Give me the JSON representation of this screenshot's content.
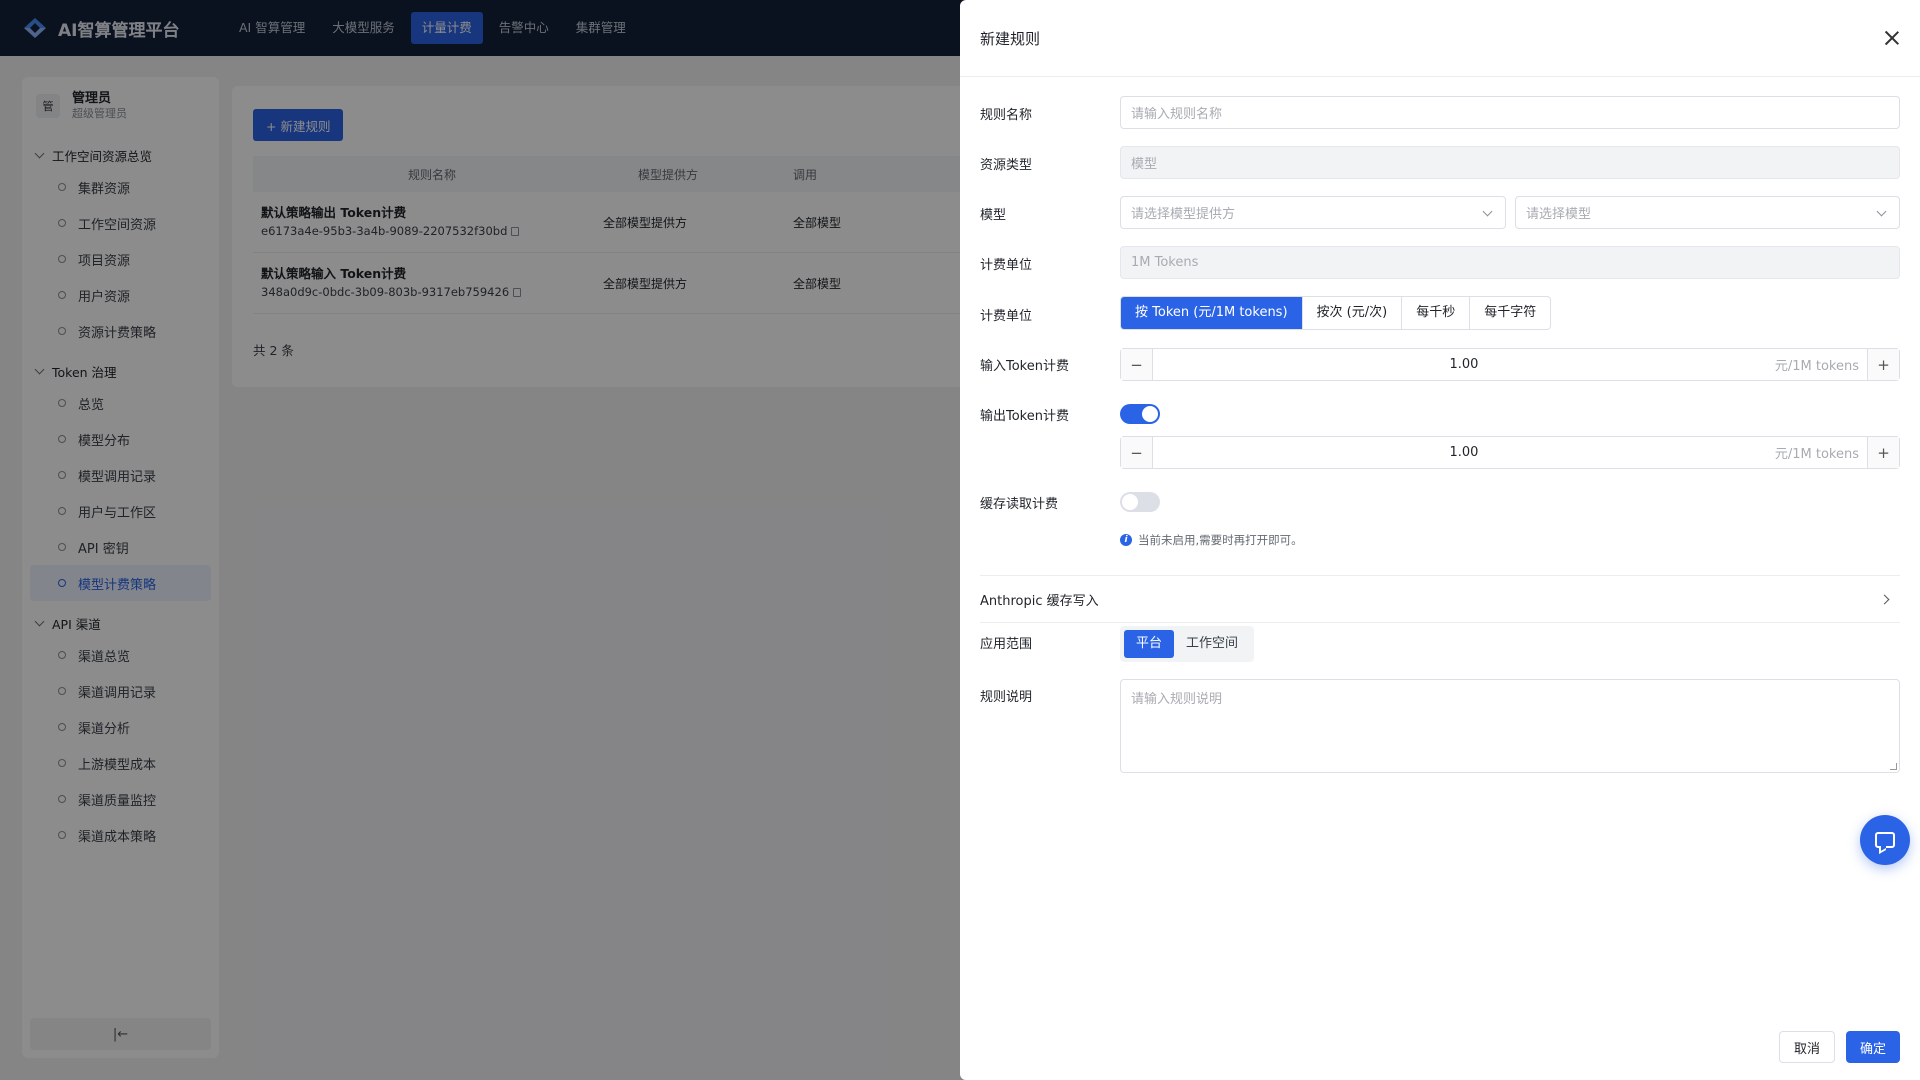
{
  "app": {
    "title": "AI智算管理平台"
  },
  "topnav": {
    "items": [
      {
        "label": "AI 智算管理"
      },
      {
        "label": "大模型服务"
      },
      {
        "label": "计量计费",
        "active": true
      },
      {
        "label": "告警中心"
      },
      {
        "label": "集群管理"
      }
    ]
  },
  "sidebar": {
    "user": {
      "avatar": "管",
      "name": "管理员",
      "role": "超级管理员"
    },
    "groups": [
      {
        "title": "工作空间资源总览",
        "items": [
          "集群资源",
          "工作空间资源",
          "项目资源",
          "用户资源",
          "资源计费策略"
        ]
      },
      {
        "title": "Token 治理",
        "items": [
          "总览",
          "模型分布",
          "模型调用记录",
          "用户与工作区",
          "API 密钥",
          "模型计费策略"
        ]
      },
      {
        "title": "API 渠道",
        "items": [
          "渠道总览",
          "渠道调用记录",
          "渠道分析",
          "上游模型成本",
          "渠道质量监控",
          "渠道成本策略"
        ]
      }
    ],
    "active_item": "模型计费策略",
    "collapse_label": "|←"
  },
  "main": {
    "new_button": "+ 新建规则",
    "columns": [
      "规则名称",
      "模型提供方",
      "调用"
    ],
    "rows": [
      {
        "name": "默认策略输出 Token计费",
        "id": "e6173a4e-95b3-3a4b-9089-2207532f30bd",
        "provider": "全部模型提供方",
        "model": "全部模型"
      },
      {
        "name": "默认策略输入 Token计费",
        "id": "348a0d9c-0bdc-3b09-803b-9317eb759426",
        "provider": "全部模型提供方",
        "model": "全部模型"
      }
    ],
    "total": "共 2 条"
  },
  "drawer": {
    "title": "新建规则",
    "fields": {
      "rule_name": {
        "label": "规则名称",
        "placeholder": "请输入规则名称"
      },
      "resource_type": {
        "label": "资源类型",
        "value": "模型"
      },
      "model": {
        "label": "模型",
        "provider_placeholder": "请选择模型提供方",
        "model_placeholder": "请选择模型"
      },
      "billing_unit": {
        "label": "计费单位",
        "value": "1M Tokens"
      },
      "billing_mode": {
        "label": "计费单位",
        "options": [
          "按 Token (元/1M tokens)",
          "按次 (元/次)",
          "每千秒",
          "每千字符"
        ],
        "selected": 0
      },
      "input_token": {
        "label": "输入Token计费",
        "value": "1.00",
        "unit": "元/1M tokens"
      },
      "output_token": {
        "label": "输出Token计费",
        "enabled": true,
        "value": "1.00",
        "unit": "元/1M tokens"
      },
      "cache_read": {
        "label": "缓存读取计费",
        "enabled": false,
        "hint": "当前未启用,需要时再打开即可。"
      },
      "anthropic": {
        "label": "Anthropic 缓存写入"
      },
      "scope": {
        "label": "应用范围",
        "options": [
          "平台",
          "工作空间"
        ],
        "selected": 0
      },
      "description": {
        "label": "规则说明",
        "placeholder": "请输入规则说明"
      }
    },
    "footer": {
      "cancel": "取消",
      "ok": "确定"
    }
  },
  "colors": {
    "primary": "#2b63e6",
    "nav_bg": "#14213a"
  }
}
